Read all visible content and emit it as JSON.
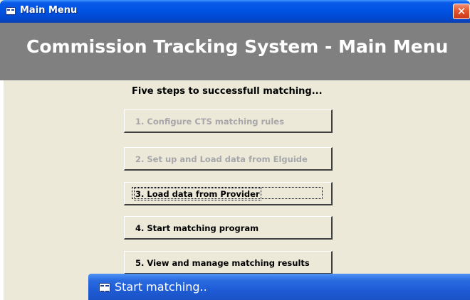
{
  "window": {
    "title": "Main Menu",
    "close_glyph": "✕",
    "icon": "form-icon"
  },
  "header": {
    "title": "Commission Tracking System - Main Menu"
  },
  "main": {
    "subtitle": "Five steps to successfull matching...",
    "steps": [
      {
        "label": "1.  Configure CTS matching rules",
        "state": "disabled"
      },
      {
        "label": "2.  Set up and Load data from Elguide",
        "state": "disabled"
      },
      {
        "label": "3.  Load data from Provider",
        "state": "focused"
      },
      {
        "label": "4.  Start matching program",
        "state": "enabled"
      },
      {
        "label": "5.  View and manage matching results",
        "state": "enabled"
      }
    ]
  },
  "taskbar": {
    "label": "Start matching..",
    "icon": "form-icon"
  },
  "colors": {
    "titlebar": "#0054e3",
    "header_band": "#808080",
    "client_bg": "#ece9d8",
    "disabled_text": "#a7a6aa",
    "close_button": "#e5562e"
  }
}
